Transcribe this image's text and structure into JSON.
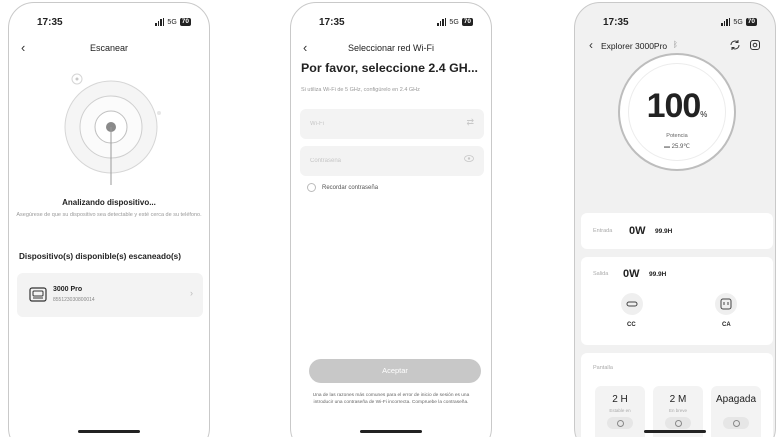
{
  "status_bar": {
    "time": "17:35",
    "network": "5G",
    "battery": "70"
  },
  "scan_screen": {
    "title": "Escanear",
    "analyzing_title": "Analizando dispositivo...",
    "analyzing_subtitle": "Asegúrese de que su dispositivo sea detectable y esté cerca de su teléfono.",
    "available_title": "Dispositivo(s) disponible(s) escaneado(s)",
    "device": {
      "name": "3000 Pro",
      "id": "855123030800014"
    }
  },
  "wifi_screen": {
    "title": "Seleccionar red Wi-Fi",
    "headline": "Por favor, seleccione 2.4 GH...",
    "hint": "Si utiliza Wi-Fi de 5 GHz, configúrelo en 2.4 GHz",
    "wifi_placeholder": "Wi-Fi",
    "password_placeholder": "Contraseña",
    "remember_label": "Recordar contraseña",
    "accept_label": "Aceptar",
    "note": "Una de las razones más comunes para el error de inicio de sesión es una introducir una contraseña de Wi-Fi incorrecta. Compruebe la contraseña."
  },
  "device_screen": {
    "device_name": "Explorer 3000Pro",
    "battery_percent": "100",
    "percent_unit": "%",
    "potencia_label": "Potencia",
    "temperature": "25.9℃",
    "input": {
      "label": "Entrada",
      "power": "0W",
      "hours": "99.9H"
    },
    "output": {
      "label": "Salida",
      "power": "0W",
      "hours": "99.9H"
    },
    "outputs": [
      {
        "label": "CC",
        "icon": "dc-outlet-icon"
      },
      {
        "label": "CA",
        "icon": "ac-outlet-icon"
      }
    ],
    "screen_label": "Pantalla",
    "screen_options": [
      {
        "value": "2 H",
        "sub": "Estable en"
      },
      {
        "value": "2 M",
        "sub": "En breve"
      },
      {
        "value": "Apagada",
        "sub": ""
      }
    ]
  }
}
